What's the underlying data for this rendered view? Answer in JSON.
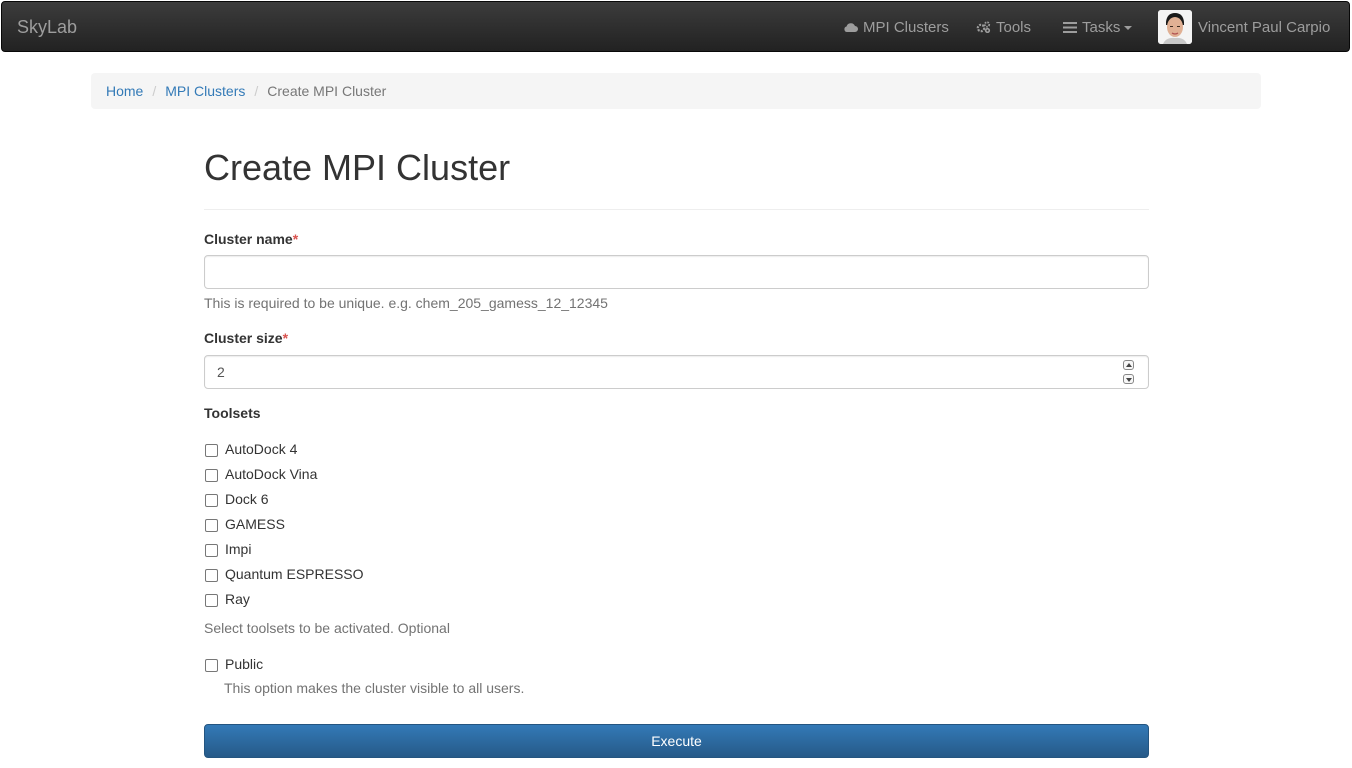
{
  "navbar": {
    "brand": "SkyLab",
    "items": [
      {
        "label": "MPI Clusters",
        "icon": "cloud-icon"
      },
      {
        "label": "Tools",
        "icon": "cogs-icon"
      },
      {
        "label": "Tasks",
        "icon": "tasks-icon"
      }
    ],
    "user_name": "Vincent Paul Carpio"
  },
  "breadcrumb": [
    "Home",
    "MPI Clusters",
    "Create MPI Cluster"
  ],
  "form": {
    "title": "Create MPI Cluster",
    "cluster_name_label": "Cluster name",
    "required_mark": "*",
    "cluster_name_value": "",
    "cluster_name_help": "This is required to be unique. e.g. chem_205_gamess_12_12345",
    "cluster_size_label": "Cluster size",
    "cluster_size_value": "2",
    "toolsets_label": "Toolsets",
    "toolsets": [
      "AutoDock 4",
      "AutoDock Vina",
      "Dock 6",
      "GAMESS",
      "Impi",
      "Quantum ESPRESSO",
      "Ray"
    ],
    "toolsets_help": "Select toolsets to be activated. Optional",
    "public_label": "Public",
    "public_help": "This option makes the cluster visible to all users.",
    "submit_label": "Execute"
  },
  "colors": {
    "navbar_bg": "#222222",
    "link": "#337ab7",
    "primary": "#337ab7",
    "required": "#d9534f"
  }
}
